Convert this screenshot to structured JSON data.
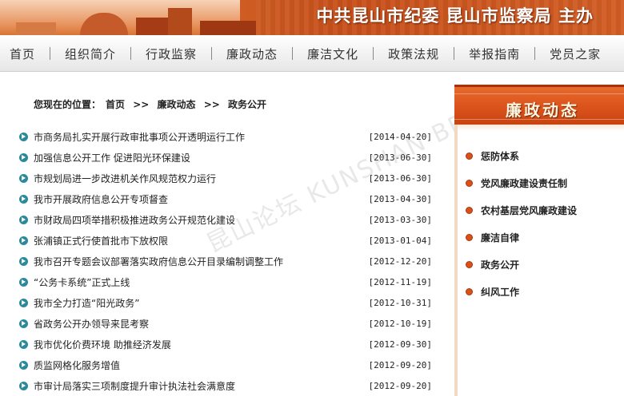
{
  "banner": {
    "title": "中共昆山市纪委  昆山市监察局  主办"
  },
  "nav": {
    "items": [
      "首页",
      "组织简介",
      "行政监察",
      "廉政动态",
      "廉洁文化",
      "政策法规",
      "举报指南",
      "党员之家"
    ]
  },
  "breadcrumb": {
    "prefix": "您现在的位置：",
    "items": [
      "首页",
      ">>",
      "廉政动态",
      ">>",
      "政务公开"
    ]
  },
  "news": [
    {
      "title": "市商务局扎实开展行政审批事项公开透明运行工作",
      "date": "[2014-04-20]"
    },
    {
      "title": "加强信息公开工作  促进阳光环保建设",
      "date": "[2013-06-30]"
    },
    {
      "title": "市规划局进一步改进机关作风规范权力运行",
      "date": "[2013-06-30]"
    },
    {
      "title": "我市开展政府信息公开专项督查",
      "date": "[2013-04-30]"
    },
    {
      "title": "市财政局四项举措积极推进政务公开规范化建设",
      "date": "[2013-03-30]"
    },
    {
      "title": "张浦镇正式行使首批市下放权限",
      "date": "[2013-01-04]"
    },
    {
      "title": "我市召开专题会议部署落实政府信息公开目录编制调整工作",
      "date": "[2012-12-20]"
    },
    {
      "title": "“公务卡系统”正式上线",
      "date": "[2012-11-19]"
    },
    {
      "title": "我市全力打造“阳光政务”",
      "date": "[2012-10-31]"
    },
    {
      "title": "省政务公开办领导来昆考察",
      "date": "[2012-10-19]"
    },
    {
      "title": "我市优化价费环境  助推经济发展",
      "date": "[2012-09-30]"
    },
    {
      "title": "质监网格化服务增值",
      "date": "[2012-09-20]"
    },
    {
      "title": "市审计局落实三项制度提升审计执法社会满意度",
      "date": "[2012-09-20]"
    }
  ],
  "watermark": "昆山论坛 KUNSHAN BBS",
  "sidebar": {
    "header": "廉政动态",
    "items": [
      "惩防体系",
      "党风廉政建设责任制",
      "农村基层党风廉政建设",
      "廉洁自律",
      "政务公开",
      "纠风工作"
    ]
  },
  "colors": {
    "accent": "#d9501a",
    "bullet": "#2a8a9c"
  }
}
